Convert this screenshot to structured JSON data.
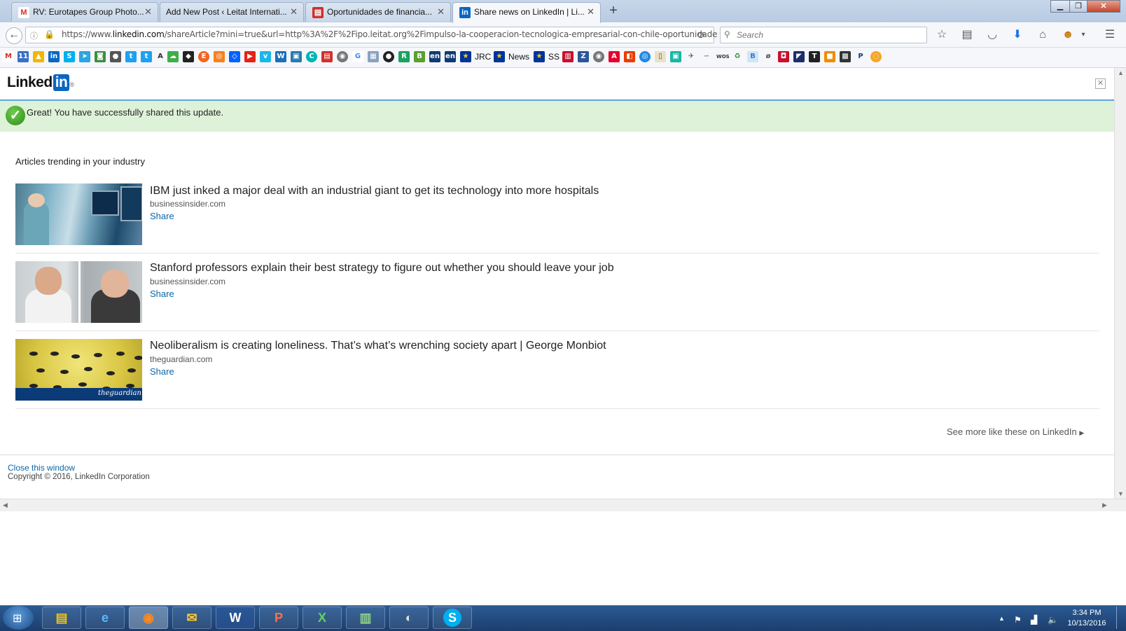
{
  "browser": {
    "tabs": [
      {
        "label": "RV: Eurotapes Group Photo...",
        "icon": "gmail-icon",
        "color": "#d93025",
        "glyph": "M"
      },
      {
        "label": "Add New Post ‹ Leitat Internati...",
        "icon": "wordpress-icon",
        "color": "#888888",
        "glyph": ""
      },
      {
        "label": "Oportunidades de financia...",
        "icon": "document-icon",
        "color": "#d0312d",
        "glyph": "▤"
      },
      {
        "label": "Share news on LinkedIn | Li...",
        "icon": "linkedin-icon",
        "color": "#0a66c2",
        "glyph": "in"
      }
    ],
    "url_prefix": "https://www.",
    "url_domain": "linkedin.com",
    "url_rest": "/shareArticle?mini=true&url=http%3A%2F%2Fipo.leitat.org%2Fimpulso-la-cooperacion-tecnologica-empresarial-con-chile-oportunidade",
    "search_placeholder": "Search",
    "bookmarks_text": {
      "jrc": "JRC",
      "news": "News",
      "ss": "SS"
    }
  },
  "page": {
    "logo_text": "Linked",
    "logo_in": "in",
    "logo_reg": "®",
    "success_message": "Great! You have successfully shared this update.",
    "section_title": "Articles trending in your industry",
    "articles": [
      {
        "title": "IBM just inked a major deal with an industrial giant to get its technology into more hospitals",
        "source": "businessinsider.com",
        "share": "Share"
      },
      {
        "title": "Stanford professors explain their best strategy to figure out whether you should leave your job",
        "source": "businessinsider.com",
        "share": "Share"
      },
      {
        "title": "Neoliberalism is creating loneliness. That’s what’s wrenching society apart | George Monbiot",
        "source": "theguardian.com",
        "share": "Share"
      }
    ],
    "thumb_caption": "theguardian",
    "see_more": "See more like these on LinkedIn",
    "close_window": "Close this window",
    "copyright": "Copyright © 2016, LinkedIn Corporation"
  },
  "taskbar": {
    "time": "3:34 PM",
    "date": "10/13/2016"
  }
}
